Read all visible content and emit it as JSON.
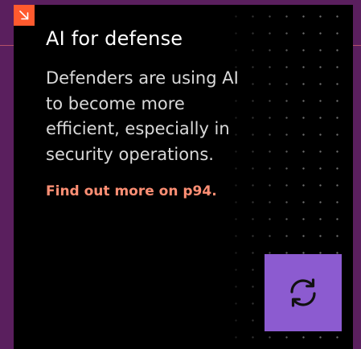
{
  "card": {
    "title": "AI for defense",
    "body": "Defenders are using AI to become more efficient, especially in security operations.",
    "cta_label": "Find out more on p94."
  },
  "icons": {
    "corner": "arrow-down-right-icon",
    "tile": "sync-icon"
  },
  "colors": {
    "background": "#5a1f5e",
    "card": "#000000",
    "accent_orange": "#ff5a2e",
    "cta": "#ff8f74",
    "tile": "#8c5bd0"
  }
}
